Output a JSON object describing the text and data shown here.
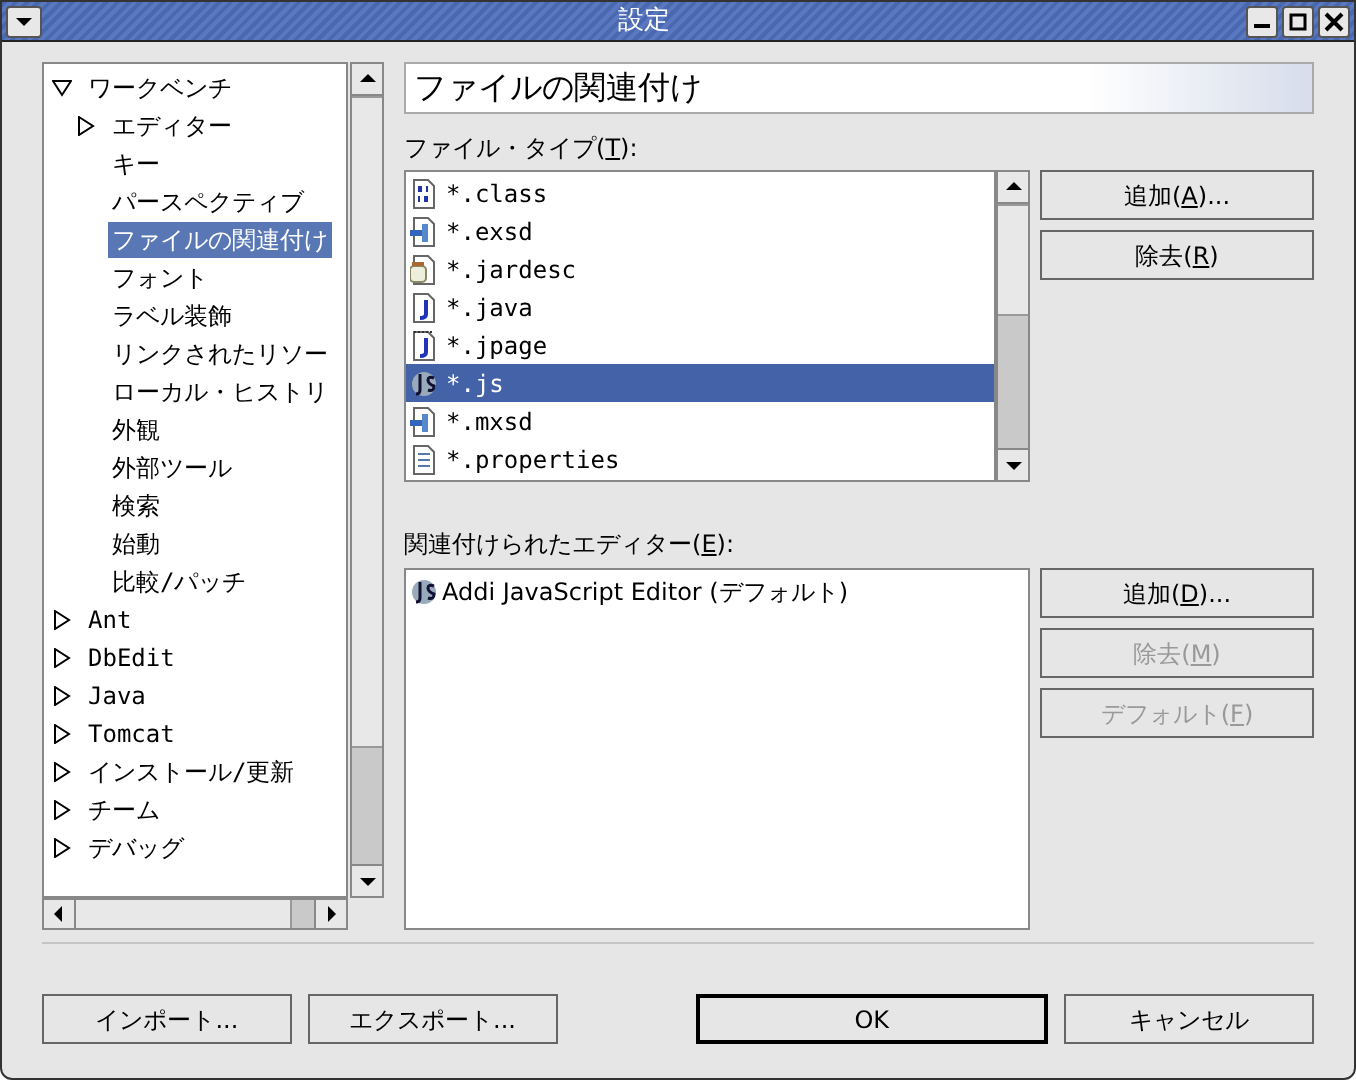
{
  "window": {
    "title": "設定"
  },
  "tree": [
    {
      "label": "ワークベンチ",
      "kind": "group",
      "expanded": true,
      "selected": false,
      "children": [
        {
          "label": "エディター",
          "kind": "group",
          "expanded": false,
          "selected": false
        },
        {
          "label": "キー",
          "kind": "page",
          "selected": false
        },
        {
          "label": "パースペクティブ",
          "kind": "page",
          "selected": false
        },
        {
          "label": "ファイルの関連付け",
          "kind": "page",
          "selected": true
        },
        {
          "label": "フォント",
          "kind": "page",
          "selected": false
        },
        {
          "label": "ラベル装飾",
          "kind": "page",
          "selected": false
        },
        {
          "label": "リンクされたリソー",
          "kind": "page",
          "selected": false
        },
        {
          "label": "ローカル・ヒストリ",
          "kind": "page",
          "selected": false
        },
        {
          "label": "外観",
          "kind": "page",
          "selected": false
        },
        {
          "label": "外部ツール",
          "kind": "page",
          "selected": false
        },
        {
          "label": "検索",
          "kind": "page",
          "selected": false
        },
        {
          "label": "始動",
          "kind": "page",
          "selected": false
        },
        {
          "label": "比較/パッチ",
          "kind": "page",
          "selected": false
        }
      ]
    },
    {
      "label": "Ant",
      "kind": "group",
      "expanded": false,
      "selected": false
    },
    {
      "label": "DbEdit",
      "kind": "group",
      "expanded": false,
      "selected": false
    },
    {
      "label": "Java",
      "kind": "group",
      "expanded": false,
      "selected": false
    },
    {
      "label": "Tomcat",
      "kind": "group",
      "expanded": false,
      "selected": false
    },
    {
      "label": "インストール/更新",
      "kind": "group",
      "expanded": false,
      "selected": false
    },
    {
      "label": "チーム",
      "kind": "group",
      "expanded": false,
      "selected": false
    },
    {
      "label": "デバッグ",
      "kind": "group",
      "expanded": false,
      "selected": false
    }
  ],
  "page_title": "ファイルの関連付け",
  "file_types": {
    "label": [
      "ファイル・タイプ(",
      "T",
      "):"
    ],
    "items": [
      {
        "name": "*.class",
        "kind": "binary",
        "selected": false
      },
      {
        "name": "*.exsd",
        "kind": "plugin",
        "selected": false
      },
      {
        "name": "*.jardesc",
        "kind": "jar",
        "selected": false
      },
      {
        "name": "*.java",
        "kind": "java",
        "selected": false
      },
      {
        "name": "*.jpage",
        "kind": "jpage",
        "selected": false
      },
      {
        "name": "*.js",
        "kind": "js",
        "selected": true
      },
      {
        "name": "*.mxsd",
        "kind": "plugin",
        "selected": false
      },
      {
        "name": "*.properties",
        "kind": "text",
        "selected": false
      }
    ],
    "buttons": [
      {
        "label": [
          "追加(",
          "A",
          ")..."
        ],
        "disabled": false
      },
      {
        "label": [
          "除去(",
          "R",
          ")"
        ],
        "disabled": false
      }
    ]
  },
  "editors": {
    "label": [
      "関連付けられたエディター(",
      "E",
      "):"
    ],
    "items": [
      {
        "name": "Addi JavaScript Editor (デフォルト)",
        "kind": "js",
        "selected": false
      }
    ],
    "buttons": [
      {
        "label": [
          "追加(",
          "D",
          ")..."
        ],
        "disabled": false
      },
      {
        "label": [
          "除去(",
          "M",
          ")"
        ],
        "disabled": true
      },
      {
        "label": [
          "デフォルト(",
          "F",
          ")"
        ],
        "disabled": true
      }
    ]
  },
  "footer_buttons": [
    {
      "label": [
        "インポート..."
      ],
      "default": false
    },
    {
      "label": [
        "エクスポート..."
      ],
      "default": false
    },
    {
      "label": [
        "OK"
      ],
      "default": true
    },
    {
      "label": [
        "キャンセル"
      ],
      "default": false
    }
  ]
}
